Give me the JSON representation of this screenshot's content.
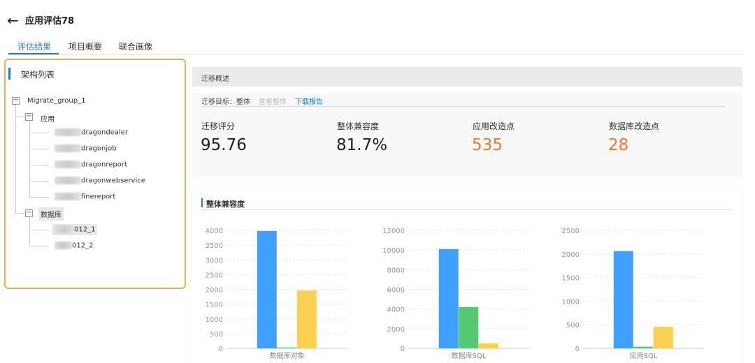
{
  "header": {
    "back_icon": "arrow-left-icon",
    "title": "应用评估78"
  },
  "tabs": [
    {
      "label": "评估结果",
      "active": true
    },
    {
      "label": "项目概要"
    },
    {
      "label": "联合画像"
    }
  ],
  "sidebar": {
    "title": "架构列表",
    "tree": {
      "root": "Migrate_group_1",
      "app_group": "应用",
      "apps": [
        "dragondealer",
        "dragonjob",
        "dragonreport",
        "dragonwebservice",
        "finereport"
      ],
      "db_group": "数据库",
      "dbs": [
        "012_1",
        "012_2"
      ]
    }
  },
  "overview": {
    "header": "迁移概述",
    "target": "迁移目标：整体",
    "view_all": "查看整体",
    "download": "下载报告",
    "metrics": [
      {
        "label": "迁移评分",
        "value": "95.76"
      },
      {
        "label": "整体兼容度",
        "value": "81.7%"
      },
      {
        "label": "应用改造点",
        "value": "535"
      },
      {
        "label": "数据库改造点",
        "value": "28"
      }
    ],
    "highlight_color": "#f07830"
  },
  "compat": {
    "title": "整体兼容度"
  },
  "chart_data": [
    {
      "type": "bar",
      "categories": [
        "数据库对象"
      ],
      "series": [
        {
          "values": [
            3980
          ],
          "color": "#3fa0ff"
        },
        {
          "values": [
            30
          ],
          "color": "#55c971"
        },
        {
          "values": [
            1960
          ],
          "color": "#f9d04f"
        }
      ],
      "ylim": [
        0,
        4000
      ],
      "yticks": [
        0,
        500,
        1000,
        1500,
        2000,
        2500,
        3000,
        3500,
        4000
      ],
      "grid": true
    },
    {
      "type": "bar",
      "categories": [
        "数据库SQL"
      ],
      "series": [
        {
          "values": [
            10100
          ],
          "color": "#3fa0ff"
        },
        {
          "values": [
            4200
          ],
          "color": "#55c971"
        },
        {
          "values": [
            500
          ],
          "color": "#f9d04f"
        }
      ],
      "ylim": [
        0,
        12000
      ],
      "yticks": [
        0,
        2000,
        4000,
        6000,
        8000,
        10000,
        12000
      ],
      "grid": true
    },
    {
      "type": "bar",
      "categories": [
        "应用SQL"
      ],
      "series": [
        {
          "values": [
            2060
          ],
          "color": "#3fa0ff"
        },
        {
          "values": [
            35
          ],
          "color": "#55c971"
        },
        {
          "values": [
            455
          ],
          "color": "#f9d04f"
        }
      ],
      "ylim": [
        0,
        2500
      ],
      "yticks": [
        0,
        500,
        1000,
        1500,
        2000,
        2500
      ],
      "grid": true
    }
  ]
}
